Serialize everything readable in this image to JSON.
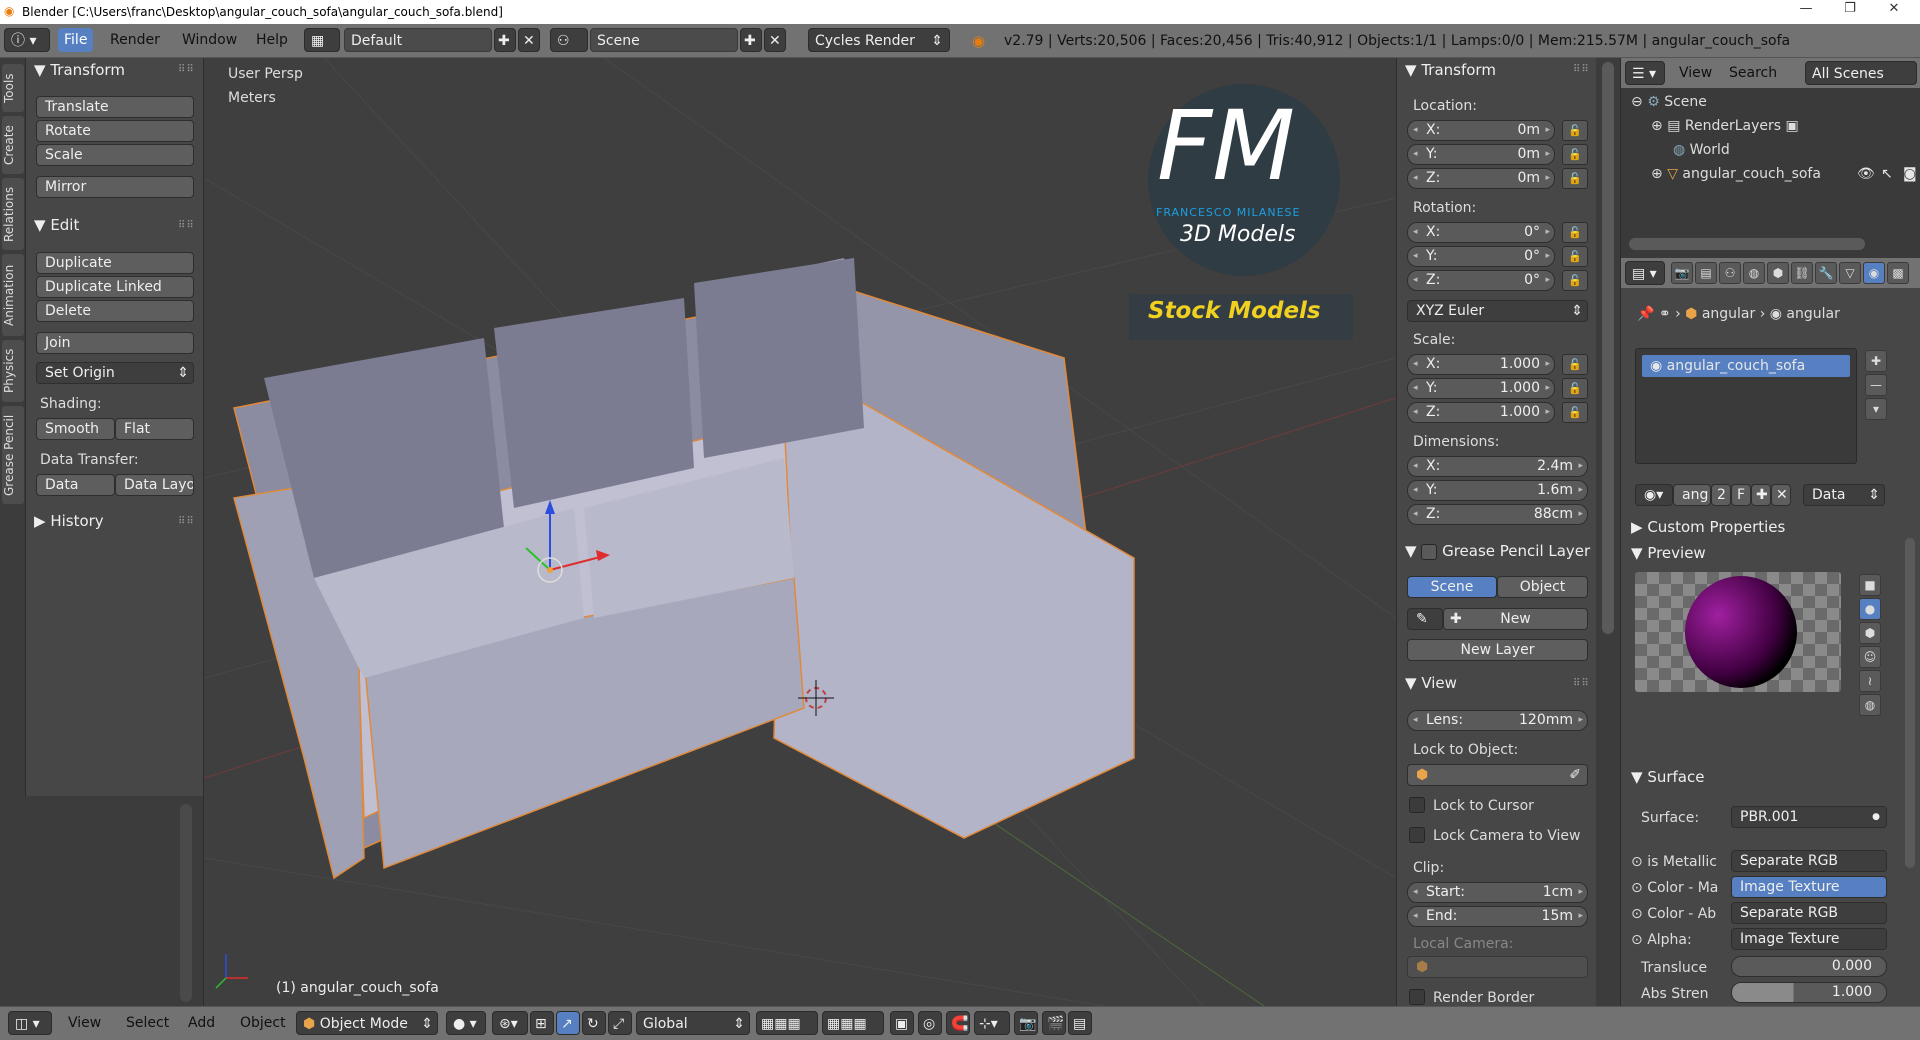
{
  "window": {
    "title": "Blender [C:\\Users\\franc\\Desktop\\angular_couch_sofa\\angular_couch_sofa.blend]",
    "min": "—",
    "max": "❐",
    "close": "✕"
  },
  "header": {
    "menus": [
      "File",
      "Render",
      "Window",
      "Help"
    ],
    "layout": "Default",
    "scene": "Scene",
    "engine": "Cycles Render",
    "stats": "v2.79 | Verts:20,506 | Faces:20,456 | Tris:40,912 | Objects:1/1 | Lamps:0/0 | Mem:215.57M | angular_couch_sofa"
  },
  "tool_tabs": [
    "Tools",
    "Create",
    "Relations",
    "Animation",
    "Physics",
    "Grease Pencil"
  ],
  "tools": {
    "transform_title": "Transform",
    "translate": "Translate",
    "rotate": "Rotate",
    "scale": "Scale",
    "mirror": "Mirror",
    "edit_title": "Edit",
    "duplicate": "Duplicate",
    "duplicate_linked": "Duplicate Linked",
    "delete": "Delete",
    "join": "Join",
    "set_origin": "Set Origin",
    "shading_label": "Shading:",
    "smooth": "Smooth",
    "flat": "Flat",
    "data_transfer_label": "Data Transfer:",
    "data": "Data",
    "data_layo": "Data Layo",
    "history_title": "History"
  },
  "viewport": {
    "view_name": "User Persp",
    "units": "Meters",
    "object_label": "(1) angular_couch_sofa",
    "logo_letters": "FM",
    "logo_name": "FRANCESCO MILANESE",
    "logo_sub": "3D Models",
    "stock": "Stock Models"
  },
  "npanel": {
    "transform_title": "Transform",
    "location_label": "Location:",
    "location": [
      {
        "k": "X:",
        "v": "0m"
      },
      {
        "k": "Y:",
        "v": "0m"
      },
      {
        "k": "Z:",
        "v": "0m"
      }
    ],
    "rotation_label": "Rotation:",
    "rotation": [
      {
        "k": "X:",
        "v": "0°"
      },
      {
        "k": "Y:",
        "v": "0°"
      },
      {
        "k": "Z:",
        "v": "0°"
      }
    ],
    "rotation_mode": "XYZ Euler",
    "scale_label": "Scale:",
    "scale": [
      {
        "k": "X:",
        "v": "1.000"
      },
      {
        "k": "Y:",
        "v": "1.000"
      },
      {
        "k": "Z:",
        "v": "1.000"
      }
    ],
    "dimensions_label": "Dimensions:",
    "dimensions": [
      {
        "k": "X:",
        "v": "2.4m"
      },
      {
        "k": "Y:",
        "v": "1.6m"
      },
      {
        "k": "Z:",
        "v": "88cm"
      }
    ],
    "grease_title": "Grease Pencil Layer",
    "scene_btn": "Scene",
    "object_btn": "Object",
    "new_btn": "New",
    "new_layer": "New Layer",
    "view_title": "View",
    "lens_label": "Lens:",
    "lens_value": "120mm",
    "lock_to_object": "Lock to Object:",
    "lock_cursor": "Lock to Cursor",
    "lock_camera": "Lock Camera to View",
    "clip_label": "Clip:",
    "start_label": "Start:",
    "start_value": "1cm",
    "end_label": "End:",
    "end_value": "15m",
    "local_camera": "Local Camera:",
    "render_border": "Render Border"
  },
  "outliner": {
    "view": "View",
    "search": "Search",
    "filter": "All Scenes",
    "items": [
      "Scene",
      "RenderLayers",
      "World",
      "angular_couch_sofa"
    ]
  },
  "properties": {
    "crumb1": "angular",
    "crumb2": "angular",
    "material": "angular_couch_sofa",
    "slot_name": "ang",
    "slot_users": "2",
    "slot_f": "F",
    "link": "Data",
    "custom_props": "Custom Properties",
    "preview": "Preview",
    "surface": "Surface",
    "surface_label": "Surface:",
    "surface_value": "PBR.001",
    "rows": [
      {
        "k": "is Metallic",
        "v": "Separate RGB"
      },
      {
        "k": "Color - Ma",
        "v": "Image Texture"
      },
      {
        "k": "Color - Ab",
        "v": "Separate RGB"
      },
      {
        "k": "Alpha:",
        "v": "Image Texture"
      }
    ],
    "transluce_label": "Transluce",
    "transluce_value": "0.000",
    "abs_label": "Abs Stren",
    "abs_value": "1.000"
  },
  "bottom": {
    "menus": [
      "View",
      "Select",
      "Add",
      "Object"
    ],
    "mode": "Object Mode",
    "orientation": "Global"
  },
  "colors": {
    "accent": "#5680c2",
    "selected_item": "#5680c2",
    "highlight_text": "#f0d020",
    "fm_blue": "#1aa0e0"
  }
}
